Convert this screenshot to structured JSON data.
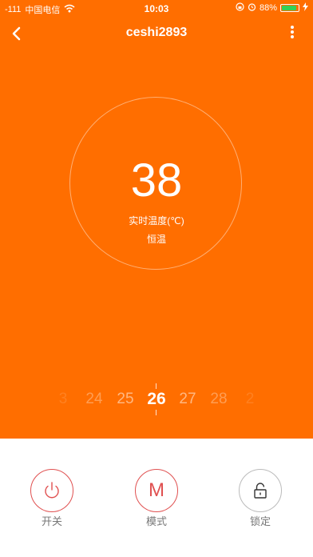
{
  "status_bar": {
    "signal": "-111",
    "carrier": "中国电信",
    "time": "10:03",
    "battery_percent": "88%",
    "battery_level": 0.88
  },
  "header": {
    "title": "ceshi2893"
  },
  "display": {
    "temperature": "38",
    "label": "实时温度(℃)",
    "mode": "恒温"
  },
  "picker": {
    "values": [
      "3",
      "24",
      "25",
      "26",
      "27",
      "28",
      "2"
    ],
    "selected": "26"
  },
  "controls": {
    "power_label": "开关",
    "mode_label": "模式",
    "mode_glyph": "M",
    "lock_label": "锁定"
  },
  "colors": {
    "primary": "#ff6e00",
    "button_accent": "#e05050",
    "lock_border": "#bbbbbb"
  }
}
